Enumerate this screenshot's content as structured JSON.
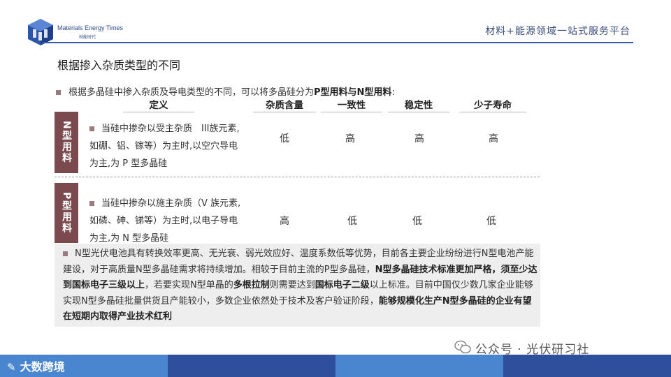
{
  "header": {
    "logo_en": "Materials Energy Times",
    "logo_cn": "材能时代",
    "platform": "材料+能源领域一站式服务平台"
  },
  "title": "根据掺入杂质类型的不同",
  "intro": {
    "prefix": "根据多晶硅中掺入杂质及导电类型的不同，可以将多晶硅分为",
    "bold": "P型用料与N型用料",
    "suffix": ":"
  },
  "table": {
    "headers": [
      "定义",
      "杂质含量",
      "一致性",
      "稳定性",
      "少子寿命"
    ],
    "rows": [
      {
        "tag": "N型用料",
        "definition": "当硅中掺杂以受主杂质　III族元素,如硼、铝、镓等）为主时,以空穴导电为主,为 P 型多晶硅",
        "values": [
          "低",
          "高",
          "高",
          "高"
        ]
      },
      {
        "tag": "P型用料",
        "definition": "当硅中掺杂以施主杂质（V 族元素,如磷、砷、锑等）为主时,以电子导电为主,为 N 型多晶硅",
        "values": [
          "高",
          "低",
          "低",
          "低"
        ]
      }
    ]
  },
  "summary": {
    "s1": "N型光伏电池具有转换效率更高、无光衰、弱光效应好、温度系数低等优势，目前各主要企业纷纷进行N型电池产能建设，对于高质量N型多晶硅需求将持续增加。相较于目前主流的P型多晶硅，",
    "b1": "N型多晶硅技术标准更加严格，须至少达到国标电子三级以上",
    "s2": "，若要实现N型单晶的",
    "b2": "多根拉制",
    "s3": "则需要达到",
    "b3": "国标电子二级",
    "s4": "以上标准。目前中国仅少数几家企业能够实现N型多晶硅批量供货且产能较小，多数企业依然处于技术及客户验证阶段，",
    "b4": "能够规模化生产N型多晶硅的企业有望在短期内取得产业技术红利"
  },
  "footer": {
    "brand": "大数跨境",
    "watermark": "公众号 · 光伏研习社"
  },
  "colors": {
    "accent": "#3359a8",
    "tag": "#7a4a4e",
    "bullet": "#9a7a7e",
    "bar_light": "#4a86d0",
    "bar_dark": "#2f4e9c"
  }
}
